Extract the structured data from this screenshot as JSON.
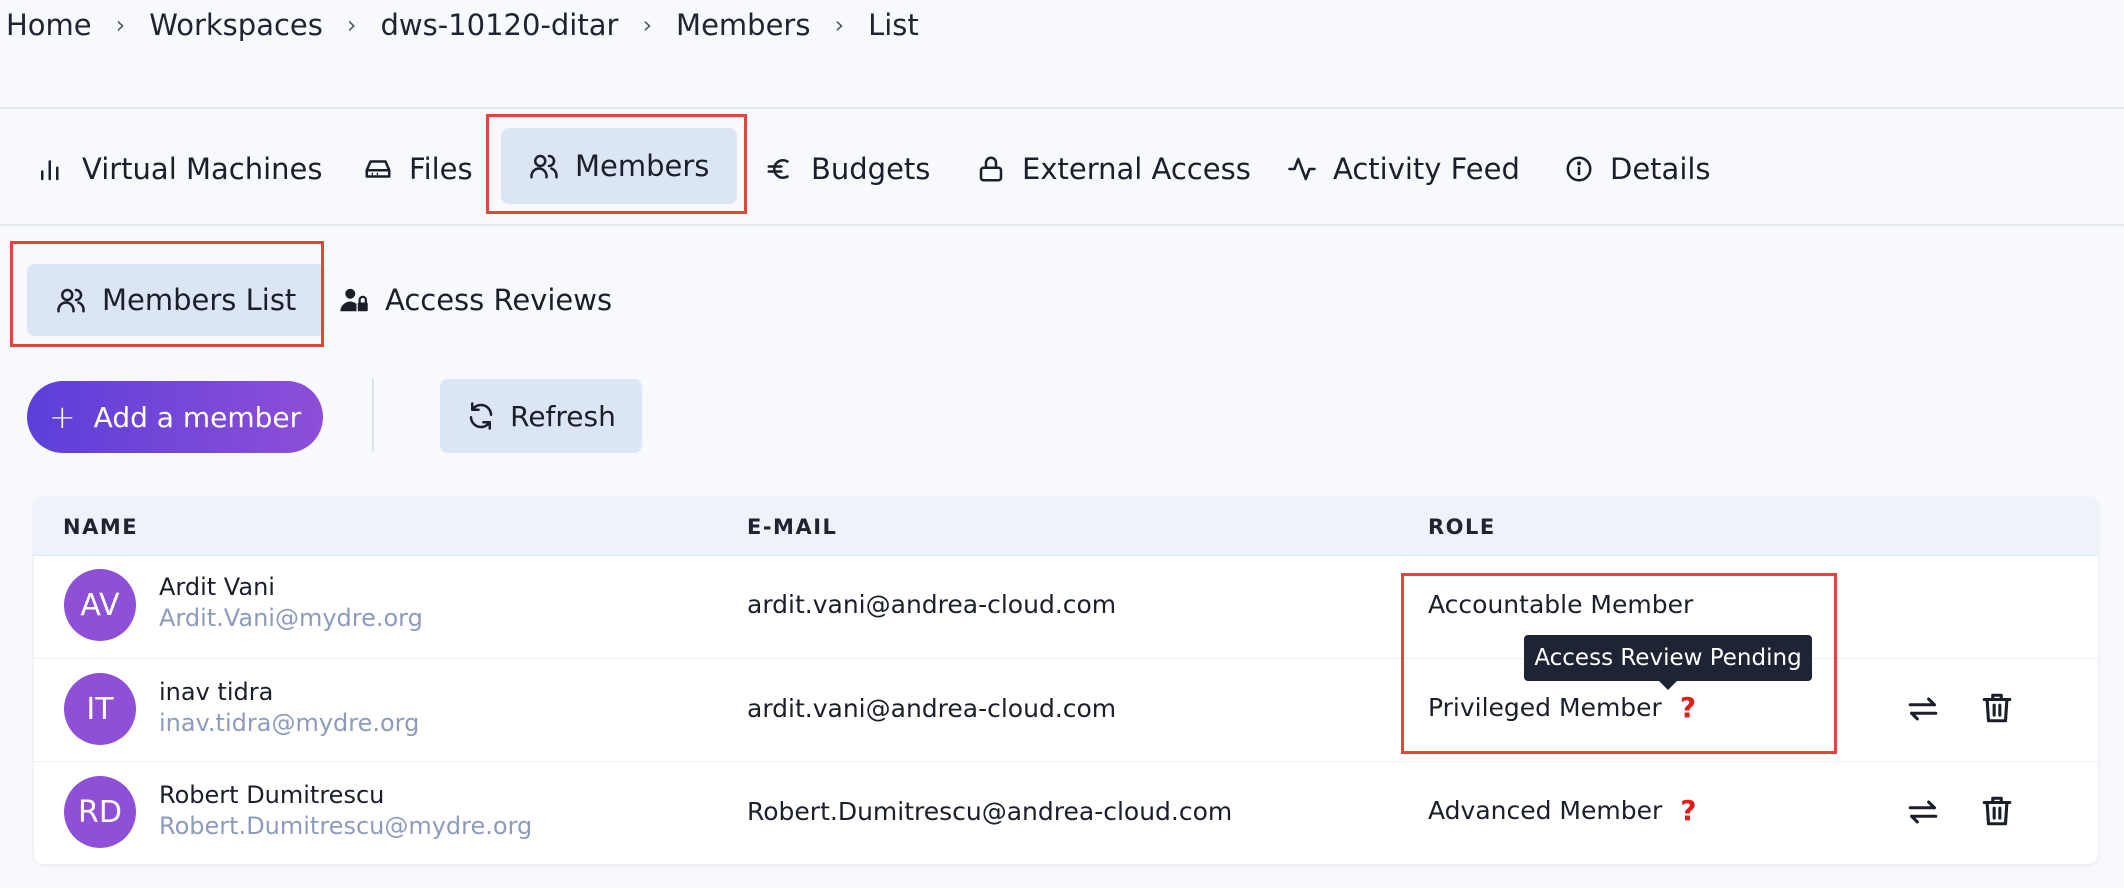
{
  "breadcrumb": [
    "Home",
    "Workspaces",
    "dws-10120-ditar",
    "Members",
    "List"
  ],
  "tabs": [
    {
      "label": "Virtual Machines",
      "icon": "bar-chart-icon"
    },
    {
      "label": "Files",
      "icon": "drive-icon"
    },
    {
      "label": "Members",
      "icon": "users-icon",
      "active": true
    },
    {
      "label": "Budgets",
      "icon": "euro-icon"
    },
    {
      "label": "External Access",
      "icon": "lock-icon"
    },
    {
      "label": "Activity Feed",
      "icon": "activity-icon"
    },
    {
      "label": "Details",
      "icon": "info-icon"
    }
  ],
  "subtabs": [
    {
      "label": "Members List",
      "icon": "users-icon",
      "active": true
    },
    {
      "label": "Access Reviews",
      "icon": "user-lock-icon"
    }
  ],
  "actions": {
    "add_label": "Add a member",
    "refresh_label": "Refresh"
  },
  "table": {
    "headers": [
      "NAME",
      "E-MAIL",
      "ROLE"
    ],
    "rows": [
      {
        "initials": "AV",
        "name": "Ardit Vani",
        "sub_email": "Ardit.Vani@mydre.org",
        "email": "ardit.vani@andrea-cloud.com",
        "role": "Accountable Member",
        "pending": false
      },
      {
        "initials": "IT",
        "name": "inav tidra",
        "sub_email": "inav.tidra@mydre.org",
        "email": "ardit.vani@andrea-cloud.com",
        "role": "Privileged Member",
        "pending": true
      },
      {
        "initials": "RD",
        "name": "Robert Dumitrescu",
        "sub_email": "Robert.Dumitrescu@mydre.org",
        "email": "Robert.Dumitrescu@andrea-cloud.com",
        "role": "Advanced Member",
        "pending": true
      }
    ]
  },
  "tooltip": "Access Review Pending",
  "pending_mark": "?",
  "colors": {
    "accent": "#6a44d8",
    "avatar": "#8f4fd6",
    "highlight": "#e2463a",
    "warning": "#e31b1b",
    "active_bg": "#dbe5f3"
  }
}
